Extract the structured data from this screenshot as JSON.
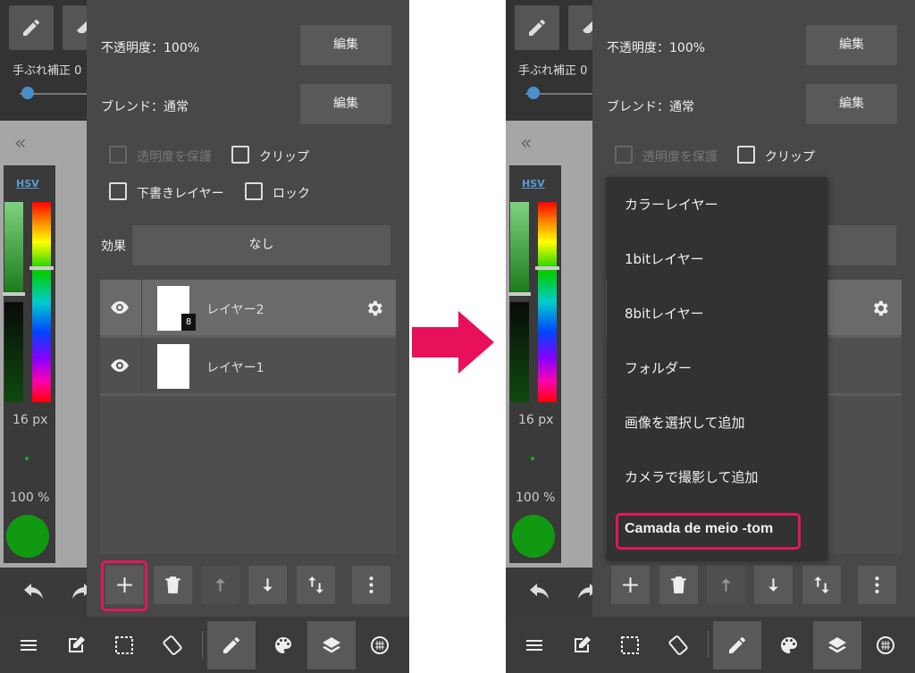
{
  "panel": {
    "opacity_label": "不透明度：100%",
    "blend_label": "ブレンド：通常",
    "edit_label": "編集",
    "protect_alpha_label": "透明度を保護",
    "clip_label": "クリップ",
    "draft_layer_label": "下書きレイヤー",
    "lock_label": "ロック",
    "effect_label": "効果",
    "effect_value": "なし"
  },
  "left_strip": {
    "stabilizer_label": "手ぶれ補正",
    "stabilizer_value": "0",
    "hsv_label": "HSV",
    "brush_size": "16 px",
    "brush_opacity": "100 %",
    "brush_color": "#119911"
  },
  "layers": [
    {
      "name": "レイヤー2",
      "badge": "8",
      "selected": true
    },
    {
      "name": "レイヤー1",
      "badge": "",
      "selected": false
    }
  ],
  "layer_actions": [
    "add-layer",
    "delete-layer",
    "move-up",
    "move-down",
    "merge",
    "more"
  ],
  "menu": {
    "items": [
      "カラーレイヤー",
      "1bitレイヤー",
      "8bitレイヤー",
      "フォルダー",
      "画像を選択して追加",
      "カメラで撮影して追加",
      "Camada de meio -tom"
    ]
  },
  "bottom_nav": [
    "menu-icon",
    "edit-icon",
    "selection-icon",
    "rotate-icon",
    "pen-icon",
    "palette-icon",
    "layers-icon",
    "snap-icon"
  ],
  "colors": {
    "highlight": "#e2185b",
    "arrow": "#e8105a",
    "accent_blue": "#4a8fc8"
  }
}
